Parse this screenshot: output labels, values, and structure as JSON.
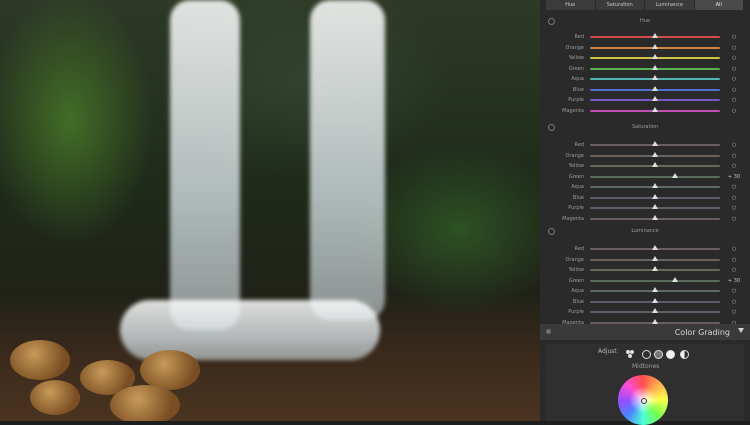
{
  "tabs": {
    "items": [
      "Hue",
      "Saturation",
      "Luminance",
      "All"
    ],
    "active_index": 3
  },
  "sections": [
    {
      "title": "Hue",
      "rows": [
        {
          "label": "Red",
          "value": 0,
          "track": "#d24b4b"
        },
        {
          "label": "Orange",
          "value": 0,
          "track": "#d48542"
        },
        {
          "label": "Yellow",
          "value": 0,
          "track": "#d1c246"
        },
        {
          "label": "Green",
          "value": 0,
          "track": "#56b24d"
        },
        {
          "label": "Aqua",
          "value": 0,
          "track": "#4fb6b4"
        },
        {
          "label": "Blue",
          "value": 0,
          "track": "#4f6fd1"
        },
        {
          "label": "Purple",
          "value": 0,
          "track": "#7b56c7"
        },
        {
          "label": "Magenta",
          "value": 0,
          "track": "#c24fb2"
        }
      ]
    },
    {
      "title": "Saturation",
      "rows": [
        {
          "label": "Red",
          "value": 0,
          "track": "#6a5f5f"
        },
        {
          "label": "Orange",
          "value": 0,
          "track": "#6a625c"
        },
        {
          "label": "Yellow",
          "value": 0,
          "track": "#6a675c"
        },
        {
          "label": "Green",
          "value": 30,
          "display": "+ 30",
          "track": "#5c6a5c"
        },
        {
          "label": "Aqua",
          "value": 0,
          "track": "#5c6a6a"
        },
        {
          "label": "Blue",
          "value": 0,
          "track": "#5c5f6a"
        },
        {
          "label": "Purple",
          "value": 0,
          "track": "#635c6a"
        },
        {
          "label": "Magenta",
          "value": 0,
          "track": "#6a5c67"
        }
      ]
    },
    {
      "title": "Luminance",
      "rows": [
        {
          "label": "Red",
          "value": 0,
          "track": "#6a5f5f"
        },
        {
          "label": "Orange",
          "value": 0,
          "track": "#6a625c"
        },
        {
          "label": "Yellow",
          "value": 0,
          "track": "#6a675c"
        },
        {
          "label": "Green",
          "value": 30,
          "display": "+ 30",
          "track": "#5c6a5c"
        },
        {
          "label": "Aqua",
          "value": 0,
          "track": "#5c6a6a"
        },
        {
          "label": "Blue",
          "value": 0,
          "track": "#5c5f6a"
        },
        {
          "label": "Purple",
          "value": 0,
          "track": "#635c6a"
        },
        {
          "label": "Magenta",
          "value": 0,
          "track": "#6a5c67"
        }
      ]
    }
  ],
  "color_grading": {
    "title": "Color Grading",
    "adjust_label": "Adjust",
    "modes": [
      "three-way",
      "shadows",
      "midtones",
      "highlights",
      "global"
    ],
    "active_mode": "midtones",
    "wheel_label": "Midtones"
  }
}
